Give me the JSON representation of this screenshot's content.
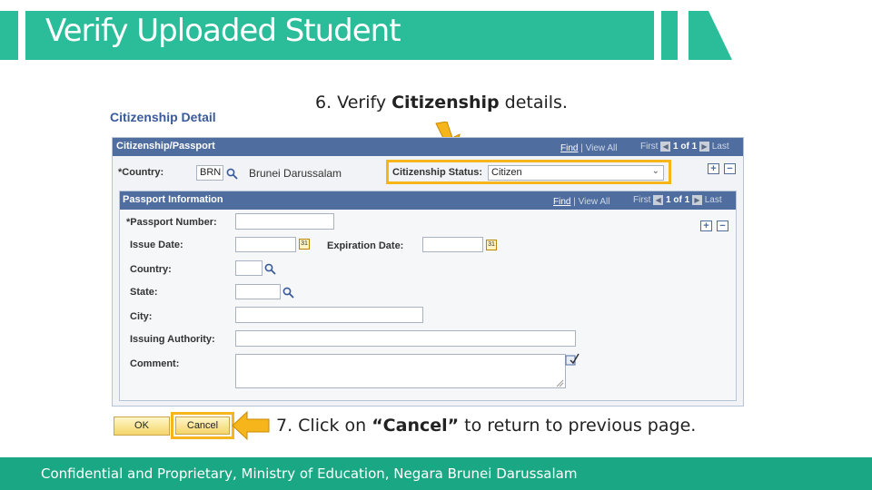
{
  "slide": {
    "title": "Verify Uploaded Student",
    "step6_prefix": "6. Verify ",
    "step6_bold": "Citizenship",
    "step6_suffix": " details.",
    "step7_prefix": "7. Click on ",
    "step7_bold": "“Cancel”",
    "step7_suffix": " to return to previous page.",
    "footer": "Confidential and Proprietary, Ministry of Education, Negara Brunei Darussalam"
  },
  "form": {
    "section_heading": "Citizenship Detail",
    "citizenship_panel": {
      "title": "Citizenship/Passport",
      "find": "Find",
      "view_all": "View All",
      "first": "First",
      "pager": "1 of 1",
      "last": "Last",
      "country_label": "*Country:",
      "country_value": "BRN",
      "country_desc": "Brunei Darussalam",
      "status_label": "Citizenship Status:",
      "status_value": "Citizen"
    },
    "passport_panel": {
      "title": "Passport Information",
      "find": "Find",
      "view_all": "View All",
      "first": "First",
      "pager": "1 of 1",
      "last": "Last",
      "passport_number_label": "*Passport Number:",
      "issue_date_label": "Issue Date:",
      "expiration_date_label": "Expiration Date:",
      "country_label": "Country:",
      "state_label": "State:",
      "city_label": "City:",
      "issuing_authority_label": "Issuing Authority:",
      "comment_label": "Comment:"
    },
    "buttons": {
      "ok": "OK",
      "cancel": "Cancel"
    }
  },
  "colors": {
    "brand_teal": "#2bbd9a",
    "footer_teal": "#1aa783",
    "panel_header": "#4f6d9f",
    "highlight": "#f6b51a"
  }
}
